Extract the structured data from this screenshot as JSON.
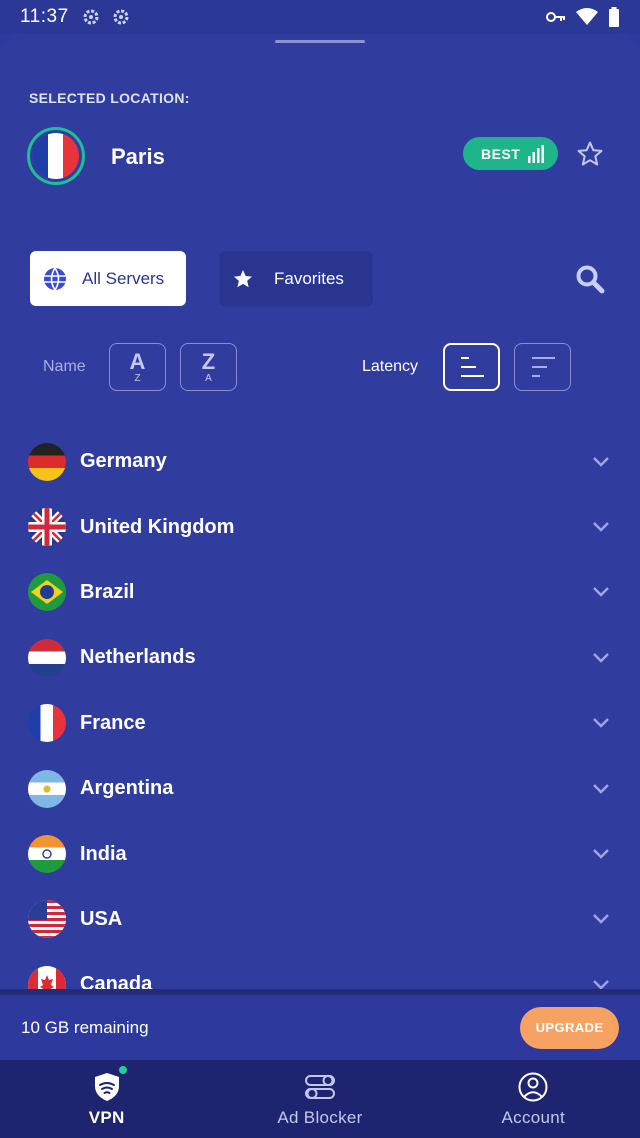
{
  "status_bar": {
    "time": "11:37",
    "icons": [
      "gear-icon",
      "gear-icon",
      "key-icon",
      "wifi-icon",
      "battery-icon"
    ]
  },
  "selected": {
    "label": "SELECTED LOCATION:",
    "city": "Paris",
    "flag": "france-flag",
    "badge": "BEST"
  },
  "tabs": [
    {
      "label": "All Servers",
      "icon": "globe-icon",
      "active": true
    },
    {
      "label": "Favorites",
      "icon": "star-icon",
      "active": false
    }
  ],
  "sort": {
    "name_label": "Name",
    "latency_label": "Latency",
    "az": {
      "top": "A",
      "bottom": "Z"
    },
    "za": {
      "top": "Z",
      "bottom": "A"
    }
  },
  "countries": [
    {
      "name": "Germany",
      "flag": "germany-flag"
    },
    {
      "name": "United Kingdom",
      "flag": "uk-flag"
    },
    {
      "name": "Brazil",
      "flag": "brazil-flag"
    },
    {
      "name": "Netherlands",
      "flag": "netherlands-flag"
    },
    {
      "name": "France",
      "flag": "france-flag"
    },
    {
      "name": "Argentina",
      "flag": "argentina-flag"
    },
    {
      "name": "India",
      "flag": "india-flag"
    },
    {
      "name": "USA",
      "flag": "usa-flag"
    },
    {
      "name": "Canada",
      "flag": "canada-flag"
    }
  ],
  "footer": {
    "remaining": "10 GB remaining",
    "upgrade": "UPGRADE"
  },
  "nav": [
    {
      "label": "VPN",
      "icon": "shield-icon",
      "active": true
    },
    {
      "label": "Ad Blocker",
      "icon": "toggles-icon",
      "active": false
    },
    {
      "label": "Account",
      "icon": "user-icon",
      "active": false
    }
  ],
  "colors": {
    "background": "#313c9f",
    "accent_green": "#1fb58a",
    "upgrade_orange": "#f5a262",
    "nav_bg": "#1f2470"
  }
}
